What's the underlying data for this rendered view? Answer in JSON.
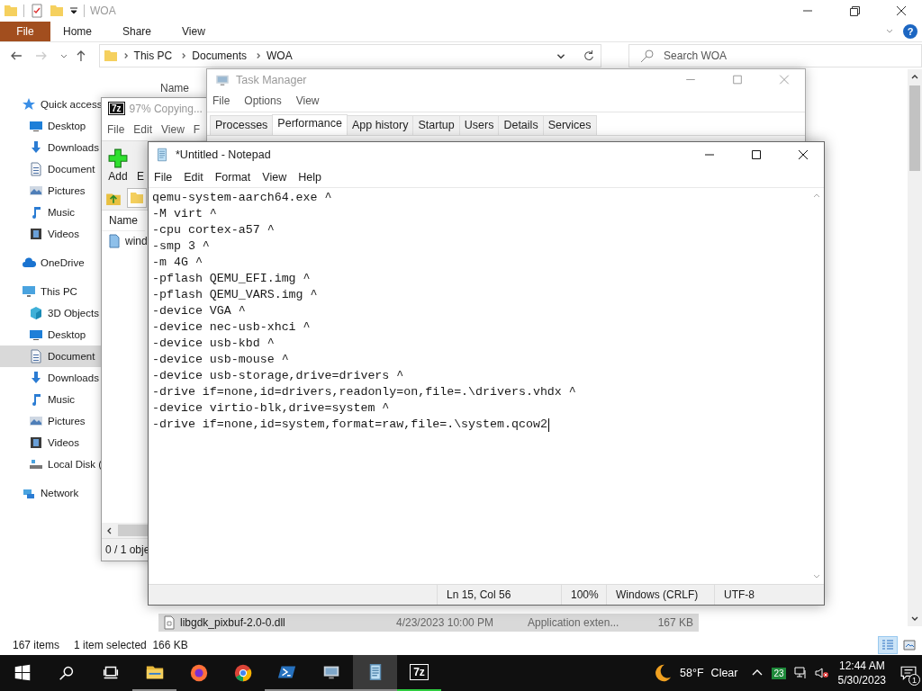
{
  "explorer": {
    "title": "WOA",
    "file_tab": "File",
    "ribbon_tabs": [
      "Home",
      "Share",
      "View"
    ],
    "help": "?",
    "path": [
      "This PC",
      "Documents",
      "WOA"
    ],
    "search": {
      "placeholder": "Search WOA"
    },
    "column_header": "Name",
    "nav": [
      {
        "label": "Quick access",
        "kind": "star",
        "selected": false,
        "children": [
          {
            "label": "Desktop",
            "kind": "desktop",
            "selected": false
          },
          {
            "label": "Downloads",
            "kind": "download",
            "selected": false
          },
          {
            "label": "Document",
            "kind": "document",
            "selected": false
          },
          {
            "label": "Pictures",
            "kind": "picture",
            "selected": false
          },
          {
            "label": "Music",
            "kind": "music",
            "selected": false
          },
          {
            "label": "Videos",
            "kind": "video",
            "selected": false
          }
        ]
      },
      {
        "label": "OneDrive",
        "kind": "cloud",
        "selected": false
      },
      {
        "label": "This PC",
        "kind": "pc",
        "selected": false,
        "children": [
          {
            "label": "3D Objects",
            "kind": "cube",
            "selected": false
          },
          {
            "label": "Desktop",
            "kind": "desktop",
            "selected": false
          },
          {
            "label": "Document",
            "kind": "document",
            "selected": true
          },
          {
            "label": "Downloads",
            "kind": "download",
            "selected": false
          },
          {
            "label": "Music",
            "kind": "music",
            "selected": false
          },
          {
            "label": "Pictures",
            "kind": "picture",
            "selected": false
          },
          {
            "label": "Videos",
            "kind": "video",
            "selected": false
          },
          {
            "label": "Local Disk (",
            "kind": "disk",
            "selected": false
          }
        ]
      },
      {
        "label": "Network",
        "kind": "network",
        "selected": false
      }
    ],
    "row": {
      "name": "libgdk_pixbuf-2.0-0.dll",
      "date": "4/23/2023 10:00 PM",
      "type": "Application exten...",
      "size": "167 KB",
      "selected": true
    },
    "status": {
      "count": "167 items",
      "selection": "1 item selected  166 KB"
    }
  },
  "sevenzip": {
    "logo": "7z",
    "title": "97% Copying...",
    "menu": [
      "File",
      "Edit",
      "View",
      "F"
    ],
    "toolbar": [
      "Add",
      "E"
    ],
    "column_header": "Name",
    "file": "wind",
    "status": "0 / 1 obje"
  },
  "task_manager": {
    "title": "Task Manager",
    "menu": [
      "File",
      "Options",
      "View"
    ],
    "tabs": [
      {
        "label": "Processes",
        "selected": false
      },
      {
        "label": "Performance",
        "selected": true
      },
      {
        "label": "App history",
        "selected": false
      },
      {
        "label": "Startup",
        "selected": false
      },
      {
        "label": "Users",
        "selected": false
      },
      {
        "label": "Details",
        "selected": false
      },
      {
        "label": "Services",
        "selected": false
      }
    ]
  },
  "notepad": {
    "title": "*Untitled - Notepad",
    "menu": [
      "File",
      "Edit",
      "Format",
      "View",
      "Help"
    ],
    "lines": [
      "qemu-system-aarch64.exe ^",
      "-M virt ^",
      "-cpu cortex-a57 ^",
      "-smp 3 ^",
      "-m 4G ^",
      "-pflash QEMU_EFI.img ^",
      "-pflash QEMU_VARS.img ^",
      "-device VGA ^",
      "-device nec-usb-xhci ^",
      "-device usb-kbd ^",
      "-device usb-mouse ^",
      "-device usb-storage,drive=drivers ^",
      "-drive if=none,id=drivers,readonly=on,file=.\\drivers.vhdx ^",
      "-device virtio-blk,drive=system ^",
      "-drive if=none,id=system,format=raw,file=.\\system.qcow2"
    ],
    "status": {
      "position": "Ln 15, Col 56",
      "zoom": "100%",
      "line_ending": "Windows (CRLF)",
      "encoding": "UTF-8"
    }
  },
  "taskbar": {
    "apps": [
      {
        "kind": "start",
        "running": false,
        "selected": false
      },
      {
        "kind": "search",
        "running": false,
        "selected": false
      },
      {
        "kind": "taskview",
        "running": false,
        "selected": false
      },
      {
        "kind": "folder",
        "running": true,
        "selected": false
      },
      {
        "kind": "firefox",
        "running": false,
        "selected": false
      },
      {
        "kind": "chrome",
        "running": false,
        "selected": false
      },
      {
        "kind": "powershell",
        "running": true,
        "selected": false
      },
      {
        "kind": "monitor",
        "running": true,
        "selected": false
      },
      {
        "kind": "notepad",
        "running": true,
        "selected": true
      },
      {
        "kind": "archiver",
        "label": "7z",
        "running": true,
        "selected": false
      }
    ],
    "weather": {
      "temperature": "58°F",
      "condition": "Clear"
    },
    "tray_badge": "23",
    "time": "12:44 AM",
    "date": "5/30/2023",
    "notifications": "1"
  }
}
